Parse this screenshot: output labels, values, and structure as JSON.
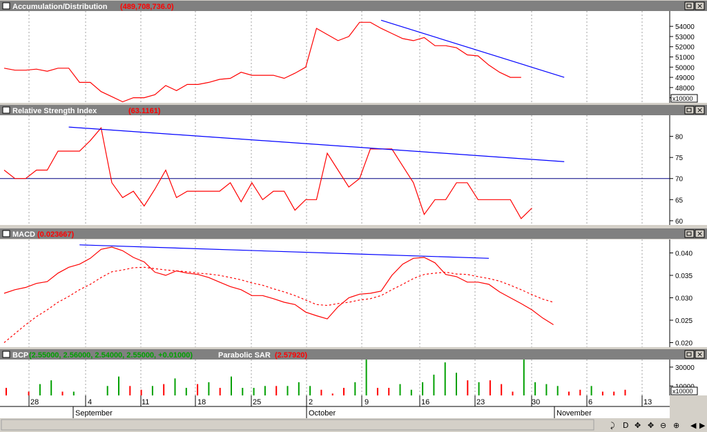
{
  "window": {
    "bg": "#d4d0c8",
    "title_bar": "#808080",
    "plot_bg": "#ffffff"
  },
  "panels": [
    {
      "id": "ad",
      "title": "Accumulation/Distribution",
      "value": "(489,708,736.0)",
      "y_unit": "x10000"
    },
    {
      "id": "rsi",
      "title": "Relative Strength Index",
      "value": "(63.1161)"
    },
    {
      "id": "macd",
      "title": "MACD",
      "value": "(0.023667)"
    },
    {
      "id": "bcp",
      "title": "BCP",
      "value": "(2.55000, 2.56000, 2.54000, 2.55000, +0.01000)",
      "title2": "Parabolic SAR",
      "value2": "(2.57920)",
      "y_unit": "x10000"
    }
  ],
  "x_axis": {
    "date_ticks": [
      "28",
      "4",
      "11",
      "18",
      "25",
      "2",
      "9",
      "16",
      "23",
      "30",
      "6",
      "13"
    ],
    "months": [
      "September",
      "October",
      "November"
    ]
  },
  "toolbar": {
    "buttons": [
      "⤸",
      "D",
      "✥",
      "✥",
      "⊖",
      "⊕",
      "◀",
      "▶"
    ]
  },
  "chart_data": [
    {
      "type": "line",
      "title": "Accumulation/Distribution",
      "ylim": [
        46500,
        55500
      ],
      "yticks": [
        47000,
        48000,
        49000,
        50000,
        51000,
        52000,
        53000,
        54000
      ],
      "series": [
        {
          "color": "#ff0000",
          "values": [
            49900,
            49700,
            49700,
            49800,
            49600,
            49900,
            49900,
            48500,
            48500,
            47600,
            47100,
            46600,
            47000,
            47000,
            47300,
            48200,
            47700,
            48300,
            48300,
            48500,
            48800,
            48900,
            49500,
            49200,
            49200,
            49200,
            48900,
            49400,
            50000,
            53800,
            53200,
            52600,
            53000,
            54400,
            54400,
            53800,
            53300,
            52800,
            52600,
            52900,
            52100,
            52100,
            51900,
            51200,
            51100,
            50200,
            49500,
            49000,
            49000
          ]
        },
        {
          "color": "#0000ff",
          "trendline": true,
          "from": [
            35,
            54600
          ],
          "to": [
            52,
            49000
          ]
        }
      ]
    },
    {
      "type": "line",
      "title": "Relative Strength Index",
      "ylim": [
        59,
        85
      ],
      "yticks": [
        60,
        65,
        70,
        75,
        80
      ],
      "reference_line": 70,
      "series": [
        {
          "color": "#ff0000",
          "values": [
            72,
            70,
            70,
            72,
            72,
            76.5,
            76.5,
            76.5,
            79,
            82,
            69,
            65.5,
            67,
            63.5,
            67.5,
            72,
            65.5,
            67,
            67,
            67,
            67,
            69,
            64.5,
            69,
            65,
            67,
            67,
            62.5,
            65,
            65,
            76,
            72,
            68,
            70,
            77,
            77,
            77,
            73,
            69,
            61.5,
            65,
            65,
            69,
            69,
            65,
            65,
            65,
            65,
            60.5,
            63
          ]
        },
        {
          "color": "#0000ff",
          "trendline": true,
          "from": [
            6,
            82.2
          ],
          "to": [
            52,
            74
          ]
        }
      ]
    },
    {
      "type": "line",
      "title": "MACD",
      "ylim": [
        0.019,
        0.043
      ],
      "yticks": [
        0.02,
        0.025,
        0.03,
        0.035,
        0.04
      ],
      "series": [
        {
          "name": "MACD",
          "color": "#ff0000",
          "style": "solid",
          "values": [
            0.031,
            0.0318,
            0.0323,
            0.0332,
            0.0336,
            0.0355,
            0.0368,
            0.0375,
            0.0388,
            0.0408,
            0.0413,
            0.0405,
            0.039,
            0.038,
            0.0357,
            0.035,
            0.036,
            0.0355,
            0.0352,
            0.0345,
            0.0335,
            0.0325,
            0.0318,
            0.0305,
            0.0305,
            0.0298,
            0.029,
            0.0285,
            0.0268,
            0.026,
            0.0253,
            0.028,
            0.03,
            0.0308,
            0.031,
            0.0315,
            0.035,
            0.0375,
            0.0388,
            0.039,
            0.0378,
            0.0352,
            0.0347,
            0.0335,
            0.0335,
            0.033,
            0.0313,
            0.03,
            0.0287,
            0.0273,
            0.0255,
            0.024
          ]
        },
        {
          "name": "Signal",
          "color": "#ff0000",
          "style": "dashed",
          "values": [
            0.02,
            0.022,
            0.024,
            0.0258,
            0.0273,
            0.029,
            0.0303,
            0.0318,
            0.033,
            0.0345,
            0.0358,
            0.0362,
            0.0367,
            0.0368,
            0.0365,
            0.0362,
            0.036,
            0.0358,
            0.0355,
            0.0353,
            0.035,
            0.0345,
            0.034,
            0.0333,
            0.0328,
            0.032,
            0.0313,
            0.0305,
            0.0295,
            0.0285,
            0.0283,
            0.0287,
            0.029,
            0.0295,
            0.0298,
            0.0305,
            0.0318,
            0.033,
            0.0343,
            0.0352,
            0.0355,
            0.0357,
            0.0353,
            0.0352,
            0.0347,
            0.0343,
            0.0337,
            0.0328,
            0.0318,
            0.0307,
            0.0297,
            0.029
          ]
        },
        {
          "color": "#0000ff",
          "trendline": true,
          "from": [
            7,
            0.0418
          ],
          "to": [
            45,
            0.0388
          ]
        }
      ]
    },
    {
      "type": "bar",
      "title": "BCP",
      "yticks": [
        10000,
        30000
      ],
      "ylim": [
        0,
        38000
      ],
      "colors": {
        "up": "#00a000",
        "down": "#ff0000"
      },
      "values": [
        8000,
        0,
        4000,
        12000,
        16000,
        4000,
        4000,
        0,
        0,
        10000,
        20000,
        10000,
        6000,
        10000,
        12000,
        18000,
        8000,
        12000,
        14000,
        8000,
        20000,
        8000,
        8000,
        10000,
        10000,
        10000,
        14000,
        10000,
        6000,
        2000,
        8000,
        14000,
        40000,
        8000,
        8000,
        12000,
        6000,
        14000,
        22000,
        35000,
        24000,
        16000,
        14000,
        16000,
        12000,
        4000,
        40000,
        14000,
        12000,
        10000,
        4000,
        6000,
        10000,
        4000,
        4000,
        6000
      ],
      "directions": [
        "d",
        "d",
        "d",
        "u",
        "u",
        "d",
        "u",
        "u",
        "u",
        "u",
        "u",
        "d",
        "d",
        "u",
        "d",
        "u",
        "u",
        "d",
        "u",
        "d",
        "u",
        "u",
        "u",
        "u",
        "d",
        "u",
        "u",
        "u",
        "d",
        "d",
        "d",
        "u",
        "u",
        "d",
        "d",
        "u",
        "u",
        "u",
        "u",
        "u",
        "u",
        "d",
        "u",
        "d",
        "d",
        "d",
        "u",
        "u",
        "u",
        "u",
        "d",
        "d",
        "u",
        "d",
        "d",
        "d"
      ]
    }
  ]
}
